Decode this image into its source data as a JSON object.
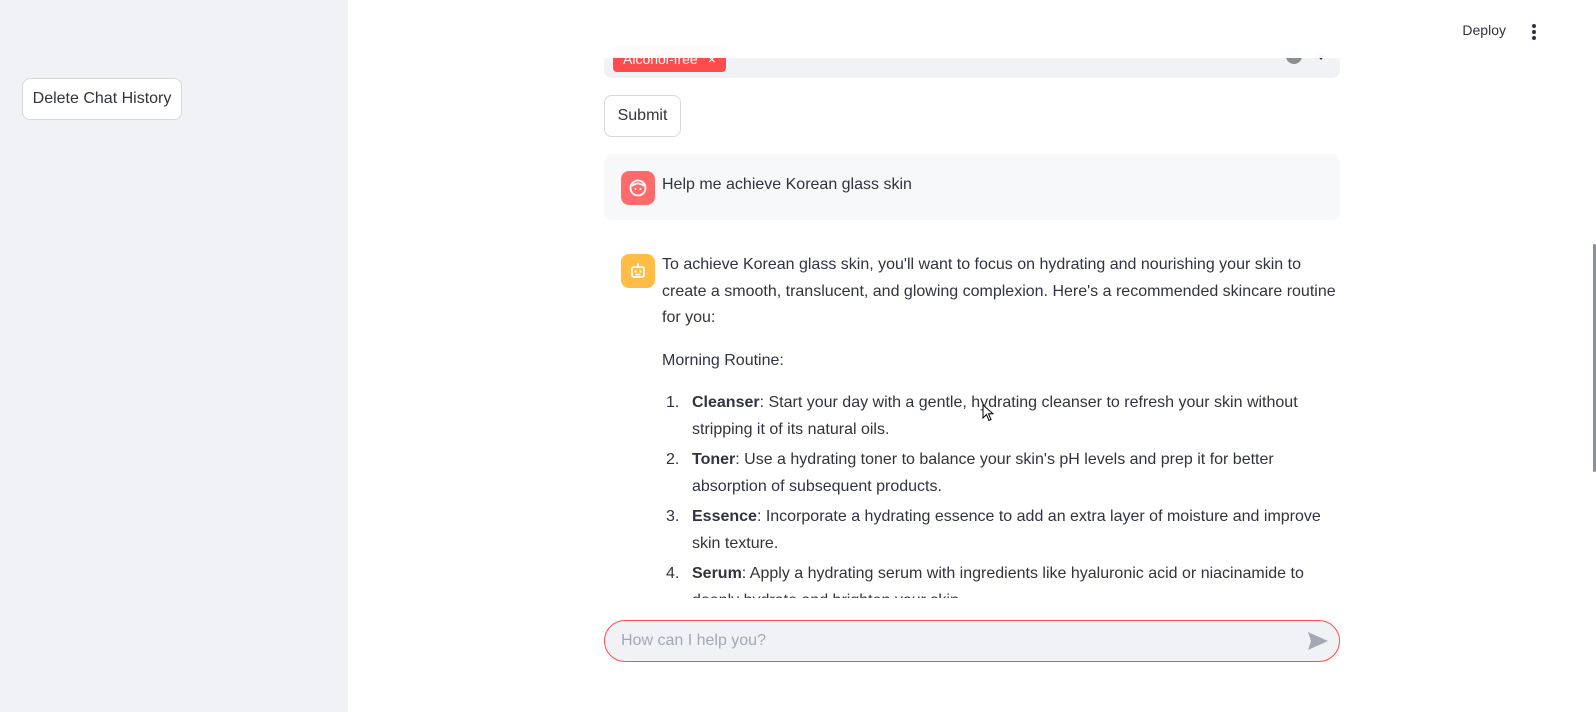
{
  "sidebar": {
    "delete_label": "Delete Chat History"
  },
  "header": {
    "deploy_label": "Deploy",
    "menu_icon": "kebab-menu-icon"
  },
  "filters": {
    "selected_tag": "Alcohol-free",
    "tag_remove": "×",
    "clear_icon": "×"
  },
  "form": {
    "submit_label": "Submit"
  },
  "messages": {
    "user": {
      "avatar_icon": "user-face-icon",
      "text": "Help me achieve Korean glass skin"
    },
    "assistant": {
      "avatar_icon": "robot-icon",
      "intro": "To achieve Korean glass skin, you'll want to focus on hydrating and nourishing your skin to create a smooth, translucent, and glowing complexion. Here's a recommended skincare routine for you:",
      "section_title": "Morning Routine:",
      "steps": [
        {
          "num": "1.",
          "title": "Cleanser",
          "text": ": Start your day with a gentle, hydrating cleanser to refresh your skin without stripping it of its natural oils."
        },
        {
          "num": "2.",
          "title": "Toner",
          "text": ": Use a hydrating toner to balance your skin's pH levels and prep it for better absorption of subsequent products."
        },
        {
          "num": "3.",
          "title": "Essence",
          "text": ": Incorporate a hydrating essence to add an extra layer of moisture and improve skin texture."
        },
        {
          "num": "4.",
          "title": "Serum",
          "text": ": Apply a hydrating serum with ingredients like hyaluronic acid or niacinamide to deeply hydrate and brighten your skin."
        }
      ]
    }
  },
  "chat_input": {
    "placeholder": "How can I help you?",
    "send_icon": "send-icon"
  },
  "colors": {
    "accent": "#ff4b4b",
    "sidebar_bg": "#f0f2f6",
    "user_avatar": "#ff6b6b",
    "bot_avatar": "#ffbd45"
  }
}
